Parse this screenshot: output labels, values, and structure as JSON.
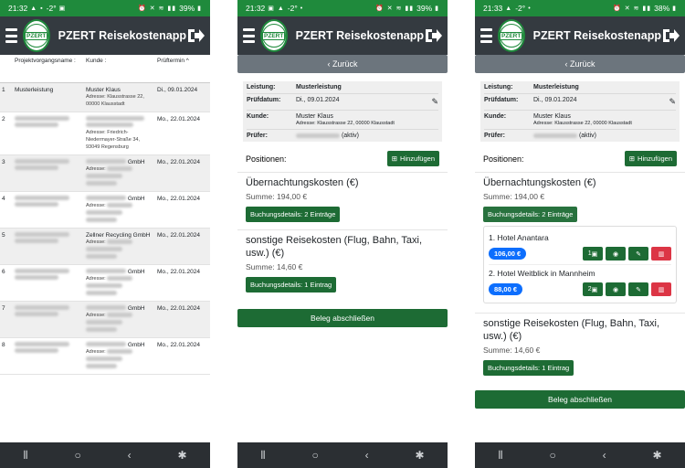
{
  "screens": [
    {
      "status": {
        "time": "21:32",
        "extra": "-2°",
        "battery": "39%"
      },
      "app_title": "PZERT Reisekostenapp",
      "logo_text": "PZERT",
      "table": {
        "headers": [
          "Projektvorgangsname :",
          "Kunde :",
          "Prüftermin ^"
        ],
        "rows": [
          {
            "n": "1",
            "name": "Musterleistung",
            "kunde": "Muster Klaus",
            "addr": "Adresse: Klausstrasse 22, 00000 Klausstadt",
            "date": "Di., 09.01.2024"
          },
          {
            "n": "2",
            "name": "",
            "kunde": "",
            "addr": "Adresse: Friedrich-Niedermayer-Straße 34, 93049 Regensburg",
            "date": "Mo., 22.01.2024"
          },
          {
            "n": "3",
            "name": "",
            "kunde": "GmbH",
            "addr": "Adresse:",
            "date": "Mo., 22.01.2024"
          },
          {
            "n": "4",
            "name": "",
            "kunde": "GmbH",
            "addr": "Adresse:",
            "date": "Mo., 22.01.2024"
          },
          {
            "n": "5",
            "name": "",
            "kunde": "Zellner Recycling GmbH",
            "addr": "Adresse:",
            "date": "Mo., 22.01.2024"
          },
          {
            "n": "6",
            "name": "",
            "kunde": "GmbH",
            "addr": "Adresse:",
            "date": "Mo., 22.01.2024"
          },
          {
            "n": "7",
            "name": "",
            "kunde": "GmbH",
            "addr": "Adresse:",
            "date": "Mo., 22.01.2024"
          },
          {
            "n": "8",
            "name": "",
            "kunde": "GmbH",
            "addr": "Adresse:",
            "date": "Mo., 22.01.2024"
          }
        ]
      }
    },
    {
      "status": {
        "time": "21:32",
        "extra": "-2°",
        "battery": "39%"
      },
      "app_title": "PZERT Reisekostenapp",
      "logo_text": "PZERT",
      "back_label": "Zurück",
      "info": {
        "leistung_label": "Leistung:",
        "leistung": "Musterleistung",
        "datum_label": "Prüfdatum:",
        "datum": "Di., 09.01.2024",
        "kunde_label": "Kunde:",
        "kunde": "Muster Klaus",
        "adresse": "Adresse: Klausstrasse 22, 00000 Klausstadt",
        "pruefer_label": "Prüfer:",
        "pruefer": "(aktiv)"
      },
      "positions_label": "Positionen:",
      "add_label": "Hinzufügen",
      "sections": [
        {
          "title": "Übernachtungskosten (€)",
          "sum": "Summe: 194,00 €",
          "btn": "Buchungsdetails: 2 Einträge"
        },
        {
          "title": "sonstige Reisekosten (Flug, Bahn, Taxi, usw.) (€)",
          "sum": "Summe: 14,60 €",
          "btn": "Buchungsdetails: 1 Eintrag"
        }
      ],
      "close_label": "Beleg abschließen"
    },
    {
      "status": {
        "time": "21:33",
        "extra": "-2°",
        "battery": "38%"
      },
      "app_title": "PZERT Reisekostenapp",
      "logo_text": "PZERT",
      "back_label": "Zurück",
      "info": {
        "leistung_label": "Leistung:",
        "leistung": "Musterleistung",
        "datum_label": "Prüfdatum:",
        "datum": "Di., 09.01.2024",
        "kunde_label": "Kunde:",
        "kunde": "Muster Klaus",
        "adresse": "Adresse: Klausstrasse 22, 00000 Klausstadt",
        "pruefer_label": "Prüfer:",
        "pruefer": "(aktiv)"
      },
      "positions_label": "Positionen:",
      "add_label": "Hinzufügen",
      "sections": [
        {
          "title": "Übernachtungskosten (€)",
          "sum": "Summe: 194,00 €",
          "btn": "Buchungsdetails: 2 Einträge"
        },
        {
          "title": "sonstige Reisekosten (Flug, Bahn, Taxi, usw.) (€)",
          "sum": "Summe: 14,60 €",
          "btn": "Buchungsdetails: 1 Eintrag"
        }
      ],
      "bookings": [
        {
          "name": "1.  Hotel Anantara",
          "amount": "106,00 €",
          "count": "1"
        },
        {
          "name": "2.  Hotel Weitblick in Mannheim",
          "amount": "88,00 €",
          "count": "2"
        }
      ],
      "close_label": "Beleg abschließen"
    }
  ],
  "colors": {
    "status_green": "#1f8a3c",
    "appbar": "#343a40",
    "btn_green": "#1d6b34",
    "pill_blue": "#0d6efd",
    "danger": "#dc3545",
    "back_gray": "#6c757d"
  },
  "icons": [
    "hamburger-icon",
    "logout-icon",
    "chevron-left-icon",
    "edit-icon",
    "plus-square-icon",
    "images-icon",
    "camera-icon",
    "trash-icon",
    "recents-icon",
    "home-icon",
    "back-icon",
    "accessibility-icon"
  ]
}
